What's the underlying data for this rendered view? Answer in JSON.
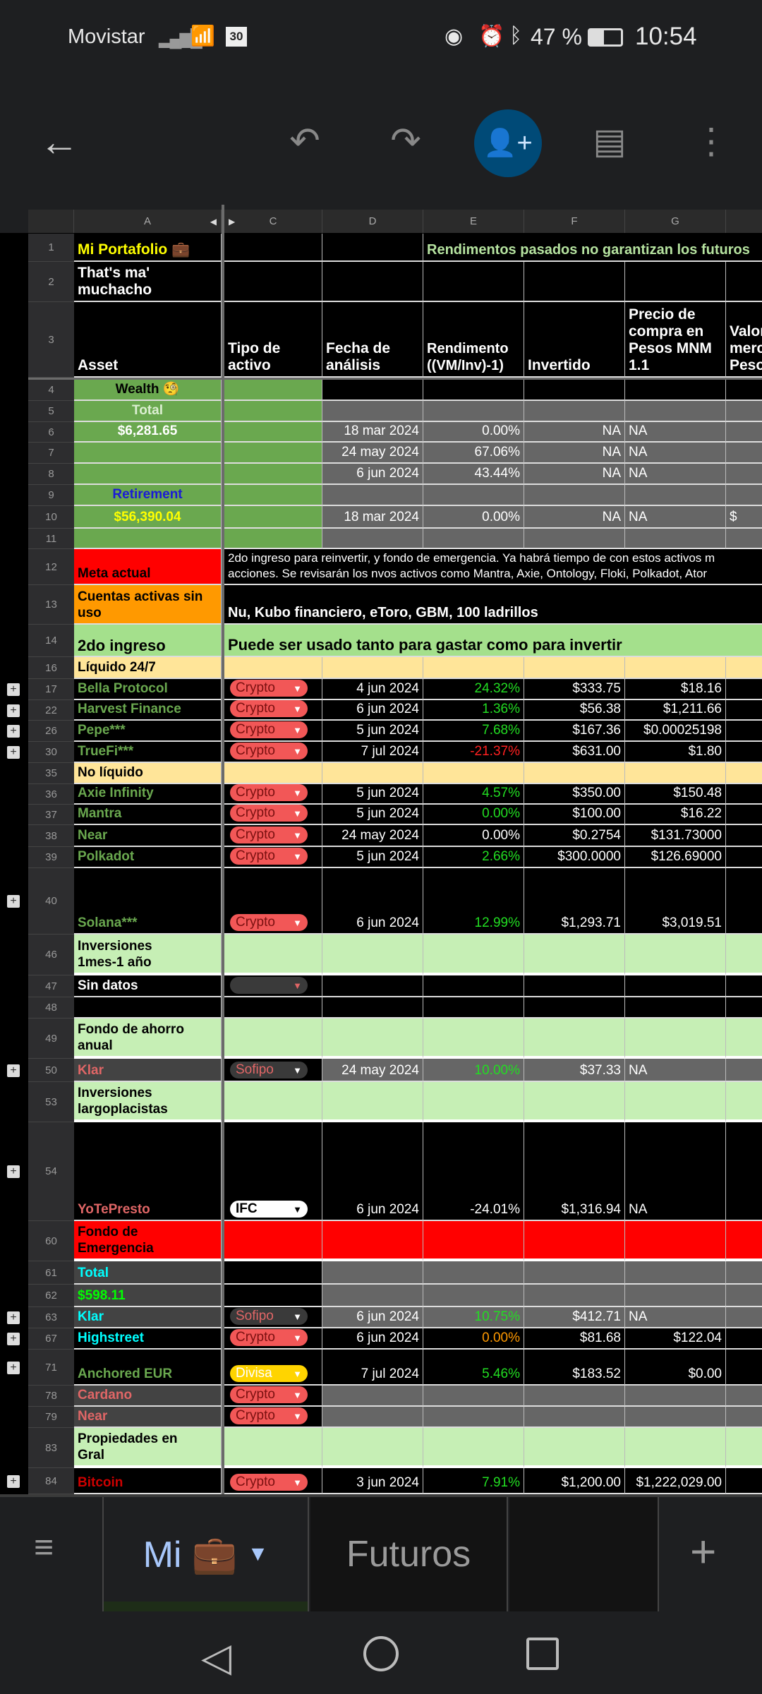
{
  "status_bar": {
    "carrier": "Movistar",
    "battery": "47 %",
    "time": "10:54",
    "date_icon_text": "30"
  },
  "toolbar": {
    "icons": [
      "back-arrow-icon",
      "undo-icon",
      "redo-icon",
      "add-person-icon",
      "comment-icon",
      "more-vert-icon"
    ],
    "accent": "#004a77"
  },
  "columns": [
    "A",
    "C",
    "D",
    "E",
    "F",
    "G"
  ],
  "headers": {
    "asset": "Asset",
    "type": "Tipo de\nactivo",
    "date": "Fecha de\nanálisis",
    "rend": "Rendimento\n((VM/Inv)-1)",
    "invested": "Invertido",
    "price": "Precio de\ncompra en\nPesos MNM\n1.1",
    "market": "Valor\nmercado\nPesos"
  },
  "title": {
    "name": "Mi Portafolio 💼",
    "subtitle": "That's ma'\nmuchacho",
    "banner": "Rendimentos pasados no garantizan los futuros"
  },
  "chip_styles": {
    "Crypto": {
      "bg": "#f25757",
      "fg": "#7a1010"
    },
    "Sofipo": {
      "bg": "#3a3a3a",
      "fg": "#e06666"
    },
    "IFC": {
      "bg": "#ffffff",
      "fg": "#000000"
    },
    "Divisa": {
      "bg": "#ffd400",
      "fg": "#ffffff"
    },
    "": {
      "bg": "#3a3a3a",
      "fg": "#e06666"
    }
  },
  "rows": [
    {
      "num": "4",
      "asset": "Wealth 🧐"
    },
    {
      "num": "5",
      "asset": "Total"
    },
    {
      "num": "6",
      "asset": "$6,281.65",
      "date": "18 mar 2024",
      "rend": "0.00%",
      "rend_color": "#ffffff",
      "invested": "NA",
      "price": "NA"
    },
    {
      "num": "7",
      "asset": "",
      "date": "24 may 2024",
      "rend": "67.06%",
      "rend_color": "#ffffff",
      "invested": "NA",
      "price": "NA"
    },
    {
      "num": "8",
      "asset": "",
      "date": "6 jun 2024",
      "rend": "43.44%",
      "rend_color": "#ffffff",
      "invested": "NA",
      "price": "NA"
    },
    {
      "num": "9",
      "asset": "Retirement"
    },
    {
      "num": "10",
      "asset": "$56,390.04",
      "date": "18 mar 2024",
      "rend": "0.00%",
      "rend_color": "#ffffff",
      "invested": "NA",
      "price": "NA",
      "market": "$"
    },
    {
      "num": "11",
      "asset": ""
    },
    {
      "num": "12",
      "asset": "Meta actual",
      "note": "2do ingreso para reinvertir, y fondo de emergencia. Ya habrá tiempo de con estos activos m\nacciones. Se revisarán los nvos activos como Mantra, Axie, Ontology, Floki, Polkadot, Ator"
    },
    {
      "num": "13",
      "asset": "Cuentas activas sin\nuso",
      "note": "Nu, Kubo financiero, eToro, GBM, 100 ladrillos"
    },
    {
      "num": "14",
      "asset": "2do ingreso",
      "note": "Puede ser usado tanto para gastar como para invertir"
    },
    {
      "num": "16",
      "asset": "Líquido 24/7"
    },
    {
      "num": "17",
      "asset": "Bella Protocol",
      "type": "Crypto",
      "date": "4 jun 2024",
      "rend": "24.32%",
      "rend_color": "#22dd22",
      "invested": "$333.75",
      "price": "$18.16"
    },
    {
      "num": "22",
      "asset": "Harvest Finance",
      "type": "Crypto",
      "date": "6 jun 2024",
      "rend": "1.36%",
      "rend_color": "#22dd22",
      "invested": "$56.38",
      "price": "$1,211.66"
    },
    {
      "num": "26",
      "asset": "Pepe***",
      "type": "Crypto",
      "date": "5 jun 2024",
      "rend": "7.68%",
      "rend_color": "#22dd22",
      "invested": "$167.36",
      "price": "$0.00025198"
    },
    {
      "num": "30",
      "asset": "TrueFi***",
      "type": "Crypto",
      "date": "7 jul 2024",
      "rend": "-21.37%",
      "rend_color": "#ff2020",
      "invested": "$631.00",
      "price": "$1.80"
    },
    {
      "num": "35",
      "asset": "No líquido"
    },
    {
      "num": "36",
      "asset": "Axie Infinity",
      "type": "Crypto",
      "date": "5 jun 2024",
      "rend": "4.57%",
      "rend_color": "#22dd22",
      "invested": "$350.00",
      "price": "$150.48"
    },
    {
      "num": "37",
      "asset": "Mantra",
      "type": "Crypto",
      "date": "5 jun 2024",
      "rend": "0.00%",
      "rend_color": "#22dd22",
      "invested": "$100.00",
      "price": "$16.22"
    },
    {
      "num": "38",
      "asset": "Near",
      "type": "Crypto",
      "date": "24 may 2024",
      "rend": "0.00%",
      "rend_color": "#ffffff",
      "invested": "$0.2754",
      "price": "$131.73000"
    },
    {
      "num": "39",
      "asset": "Polkadot",
      "type": "Crypto",
      "date": "5 jun 2024",
      "rend": "2.66%",
      "rend_color": "#22dd22",
      "invested": "$300.0000",
      "price": "$126.69000"
    },
    {
      "num": "40",
      "asset": "Solana***",
      "type": "Crypto",
      "date": "6 jun 2024",
      "rend": "12.99%",
      "rend_color": "#22dd22",
      "invested": "$1,293.71",
      "price": "$3,019.51"
    },
    {
      "num": "46",
      "asset": "Inversiones\n1mes-1 año"
    },
    {
      "num": "47",
      "asset": "Sin datos",
      "type": ""
    },
    {
      "num": "48",
      "asset": ""
    },
    {
      "num": "49",
      "asset": "Fondo de ahorro\nanual"
    },
    {
      "num": "50",
      "asset": "Klar",
      "type": "Sofipo",
      "date": "24 may 2024",
      "rend": "10.00%",
      "rend_color": "#22dd22",
      "invested": "$37.33",
      "price": "NA"
    },
    {
      "num": "53",
      "asset": "Inversiones\nlargoplacistas"
    },
    {
      "num": "54",
      "asset": "YoTePresto",
      "type": "IFC",
      "date": "6 jun 2024",
      "rend": "-24.01%",
      "rend_color": "#ffffff",
      "invested": "$1,316.94",
      "price": "NA"
    },
    {
      "num": "60",
      "asset": "Fondo de\nEmergencia"
    },
    {
      "num": "61",
      "asset": "Total"
    },
    {
      "num": "62",
      "asset": "$598.11"
    },
    {
      "num": "63",
      "asset": "Klar",
      "type": "Sofipo",
      "date": "6 jun 2024",
      "rend": "10.75%",
      "rend_color": "#22dd22",
      "invested": "$412.71",
      "price": "NA"
    },
    {
      "num": "67",
      "asset": "Highstreet",
      "type": "Crypto",
      "date": "6 jun 2024",
      "rend": "0.00%",
      "rend_color": "#ff9900",
      "invested": "$81.68",
      "price": "$122.04"
    },
    {
      "num": "71",
      "asset": "Anchored EUR",
      "type": "Divisa",
      "date": "7 jul 2024",
      "rend": "5.46%",
      "rend_color": "#22dd22",
      "invested": "$183.52",
      "price": "$0.00"
    },
    {
      "num": "78",
      "asset": "Cardano",
      "type": "Crypto"
    },
    {
      "num": "79",
      "asset": "Near",
      "type": "Crypto"
    },
    {
      "num": "83",
      "asset": "Propiedades en\nGral"
    },
    {
      "num": "84",
      "asset": "Bitcoin",
      "type": "Crypto",
      "date": "3 jun 2024",
      "rend": "7.91%",
      "rend_color": "#22dd22",
      "invested": "$1,200.00",
      "price": "$1,222,029.00"
    }
  ],
  "sheet_tabs": [
    {
      "label": "Mi 💼",
      "active": true
    },
    {
      "label": "Futuros",
      "active": false
    }
  ],
  "tab_bar": {
    "add_label": "+"
  }
}
